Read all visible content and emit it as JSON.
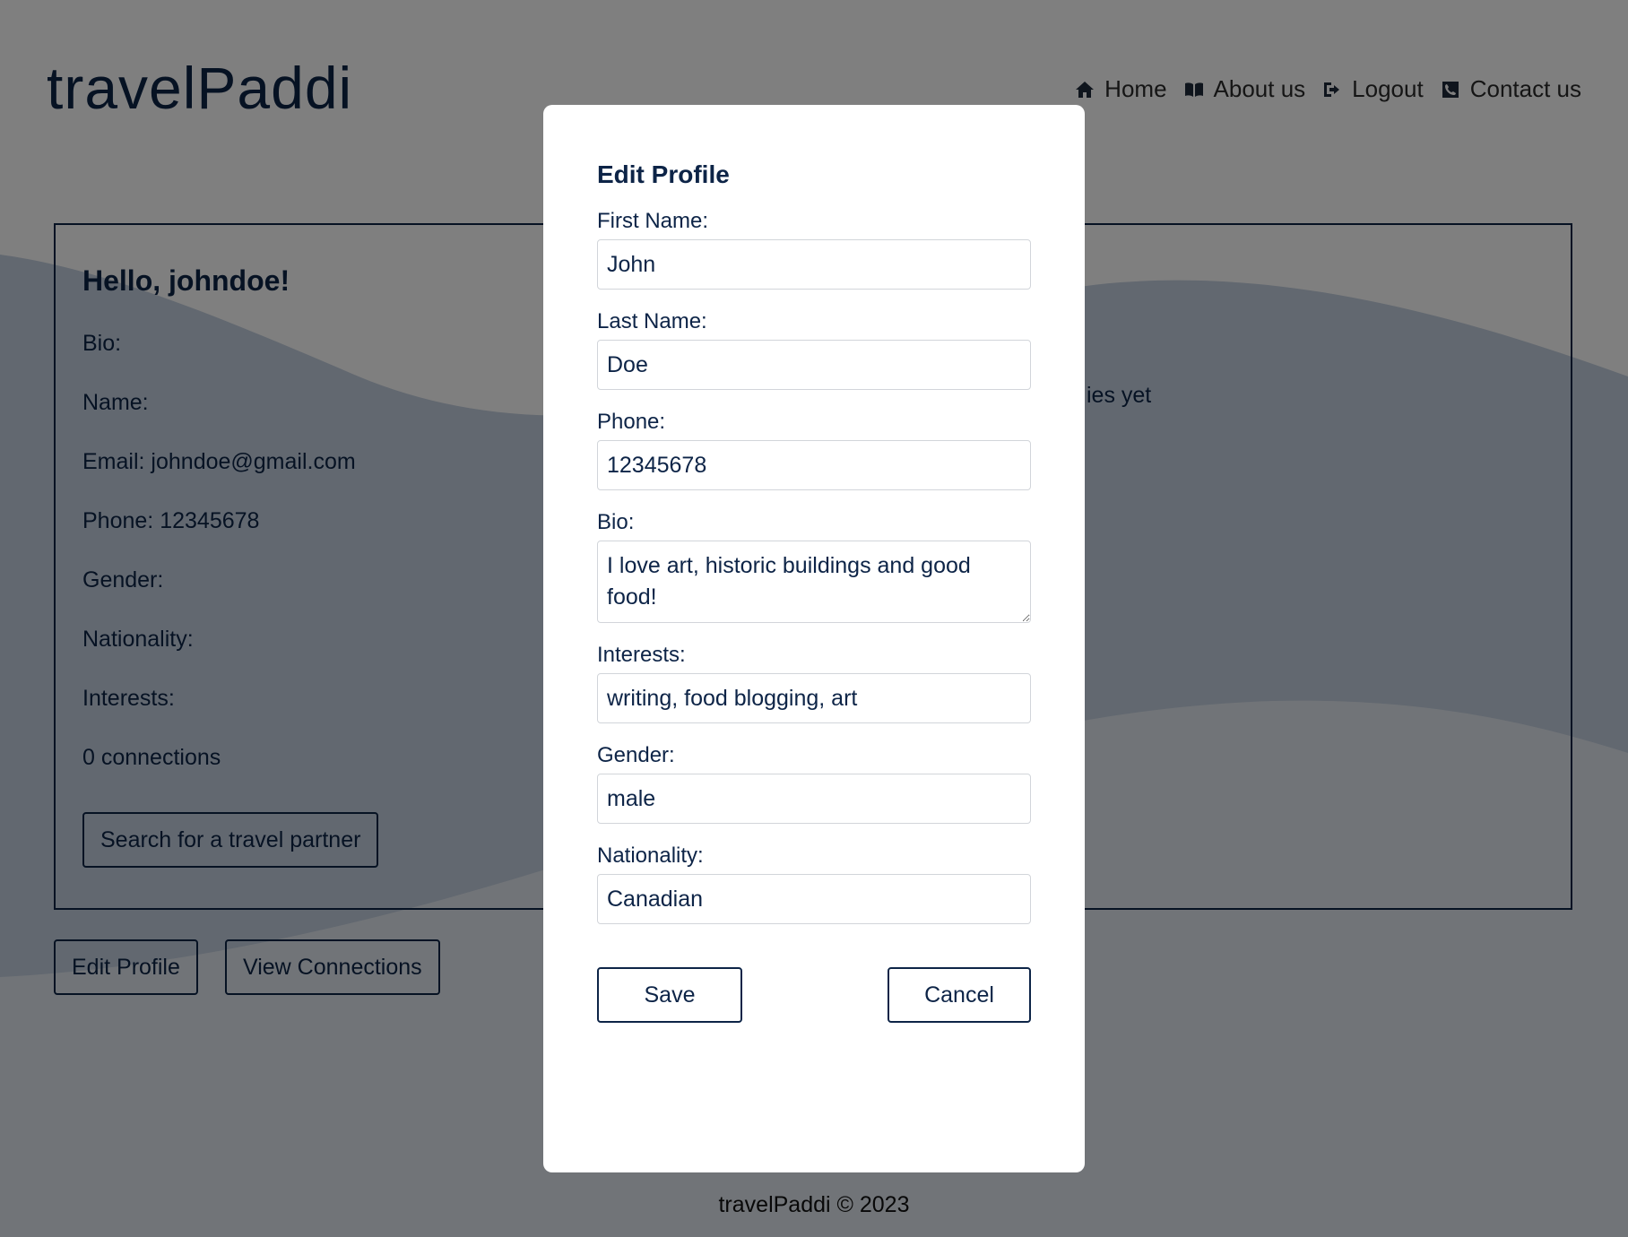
{
  "header": {
    "logo": "travelPaddi",
    "nav": [
      {
        "label": "Home",
        "icon": "home-icon"
      },
      {
        "label": "About us",
        "icon": "book-icon"
      },
      {
        "label": "Logout",
        "icon": "logout-icon"
      },
      {
        "label": "Contact us",
        "icon": "phone-icon"
      }
    ]
  },
  "profile_card": {
    "greeting": "Hello, johndoe!",
    "rows": [
      {
        "label": "Bio:",
        "value": ""
      },
      {
        "label": "Name:",
        "value": ""
      },
      {
        "label": "Email:",
        "value": "johndoe@gmail.com"
      },
      {
        "label": "Phone:",
        "value": "12345678"
      },
      {
        "label": "Gender:",
        "value": ""
      },
      {
        "label": "Nationality:",
        "value": ""
      },
      {
        "label": "Interests:",
        "value": ""
      }
    ],
    "connections": "0 connections",
    "search_button": "Search for a travel partner",
    "right_peek_text": "ies yet"
  },
  "actions": {
    "edit_profile": "Edit Profile",
    "view_connections": "View Connections"
  },
  "footer": {
    "text": "travelPaddi © 2023"
  },
  "modal": {
    "title": "Edit Profile",
    "fields": {
      "first_name": {
        "label": "First Name:",
        "value": "John"
      },
      "last_name": {
        "label": "Last Name:",
        "value": "Doe"
      },
      "phone": {
        "label": "Phone:",
        "value": "12345678"
      },
      "bio": {
        "label": "Bio:",
        "value": "I love art, historic buildings and good food!"
      },
      "interests": {
        "label": "Interests:",
        "value": "writing, food blogging, art"
      },
      "gender": {
        "label": "Gender:",
        "value": "male"
      },
      "nationality": {
        "label": "Nationality:",
        "value": "Canadian"
      }
    },
    "save_label": "Save",
    "cancel_label": "Cancel"
  },
  "colors": {
    "brand_navy": "#0d2447",
    "wave_dark": "#c4d0e0",
    "wave_light": "#e3e9f1",
    "overlay": "rgba(0,0,0,0.5)"
  }
}
